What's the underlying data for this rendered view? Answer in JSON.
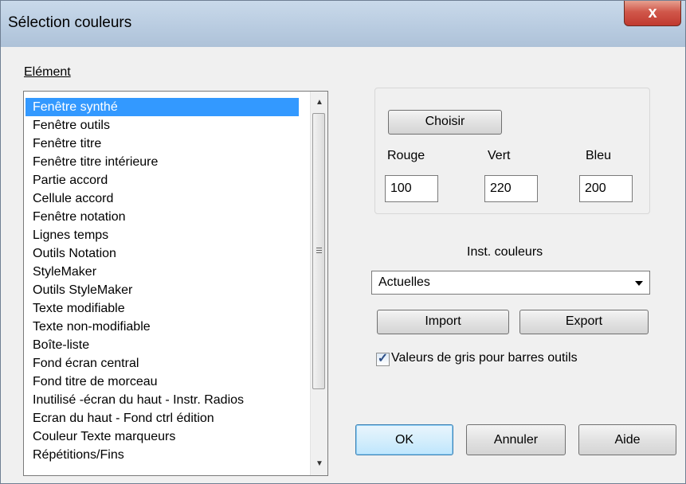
{
  "window": {
    "title": "Sélection couleurs",
    "close_glyph": "x"
  },
  "element_label": "Elément",
  "list": {
    "items": [
      "Fenêtre synthé",
      "Fenêtre outils",
      "Fenêtre titre",
      "Fenêtre titre intérieure",
      "Partie accord",
      "Cellule accord",
      "Fenêtre notation",
      "Lignes temps",
      "Outils Notation",
      "StyleMaker",
      "Outils StyleMaker",
      "Texte modifiable",
      "Texte non-modifiable",
      "Boîte-liste",
      "Fond écran central",
      "Fond titre de morceau",
      "Inutilisé -écran du haut - Instr. Radios",
      "Ecran du haut - Fond ctrl édition",
      "Couleur Texte marqueurs",
      "Répétitions/Fins"
    ],
    "selected_index": 0
  },
  "color_panel": {
    "choose_button": "Choisir",
    "red_label": "Rouge",
    "green_label": "Vert",
    "blue_label": "Bleu",
    "red_value": "100",
    "green_value": "220",
    "blue_value": "200"
  },
  "color_sets": {
    "label": "Inst. couleurs",
    "selected": "Actuelles",
    "import_button": "Import",
    "export_button": "Export"
  },
  "gray_checkbox": {
    "label": "Valeurs de gris pour barres outils",
    "checked": true
  },
  "footer": {
    "ok": "OK",
    "cancel": "Annuler",
    "help": "Aide"
  },
  "colors": {
    "selection": "#3399ff",
    "title_bar": "#b8cbe0",
    "close": "#c0392f",
    "dialog_bg": "#f0f0f0"
  }
}
